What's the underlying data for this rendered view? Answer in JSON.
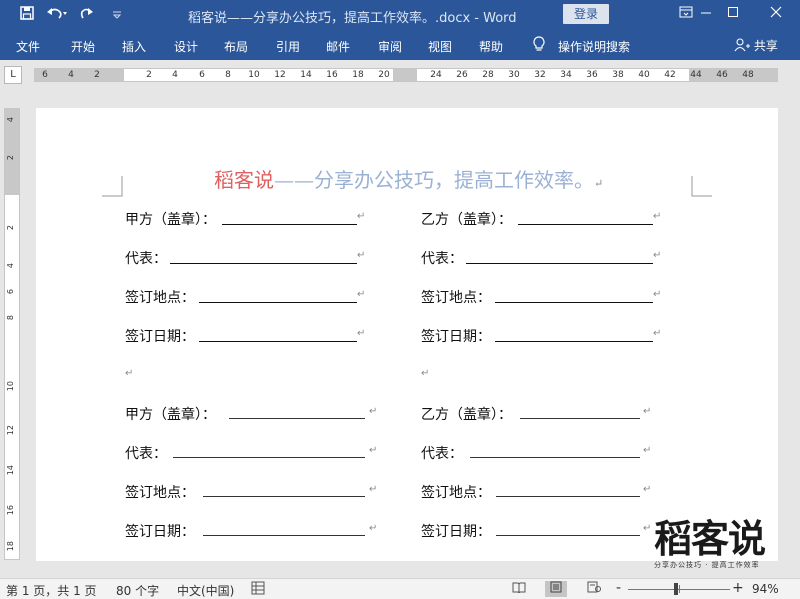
{
  "window": {
    "title": "稻客说——分享办公技巧，提高工作效率。.docx - Word",
    "login_label": "登录",
    "controls": [
      "restore-ribbon-icon",
      "minimize-icon",
      "maximize-icon",
      "close-icon"
    ]
  },
  "quick_access": {
    "icons": [
      "save-icon",
      "undo-icon",
      "redo-icon",
      "customize-icon"
    ]
  },
  "ribbon": {
    "tabs": [
      "文件",
      "开始",
      "插入",
      "设计",
      "布局",
      "引用",
      "邮件",
      "审阅",
      "视图",
      "帮助"
    ],
    "tell_me": "操作说明搜索",
    "share": "共享"
  },
  "ruler": {
    "tab_selector": "L",
    "left_numbers": [
      "6",
      "4",
      "2"
    ],
    "numbers": [
      "2",
      "4",
      "6",
      "8",
      "10",
      "12",
      "14",
      "16",
      "18",
      "20",
      "24",
      "26",
      "28",
      "30",
      "32",
      "34",
      "36",
      "38",
      "40",
      "42",
      "44",
      "46",
      "48"
    ],
    "vertical_numbers": [
      "4",
      "2",
      "2",
      "4",
      "6",
      "8",
      "10",
      "12",
      "14",
      "16",
      "18"
    ]
  },
  "document": {
    "title_red": "稻客说",
    "title_rest": "——分享办公技巧，提高工作效率。",
    "paragraph_mark": "↵",
    "section1": {
      "left": [
        "甲方（盖章）：",
        "代表：",
        "签订地点：",
        "签订日期："
      ],
      "right": [
        "乙方（盖章）：",
        "代表：",
        "签订地点：",
        "签订日期："
      ]
    },
    "section2": {
      "left": [
        "甲方（盖章）：",
        "代表：",
        "签订地点：",
        "签订日期："
      ],
      "right": [
        "乙方（盖章）：",
        "代表：",
        "签订地点：",
        "签订日期："
      ]
    }
  },
  "logo": {
    "main": "稻客说",
    "sub": "分享办公技巧 · 提高工作效率"
  },
  "status": {
    "page": "第 1 页，共 1 页",
    "words": "80 个字",
    "language": "中文(中国)",
    "zoom_minus": "-",
    "zoom_plus": "+",
    "zoom": "94%",
    "zoom_level_fraction": 0.47
  }
}
